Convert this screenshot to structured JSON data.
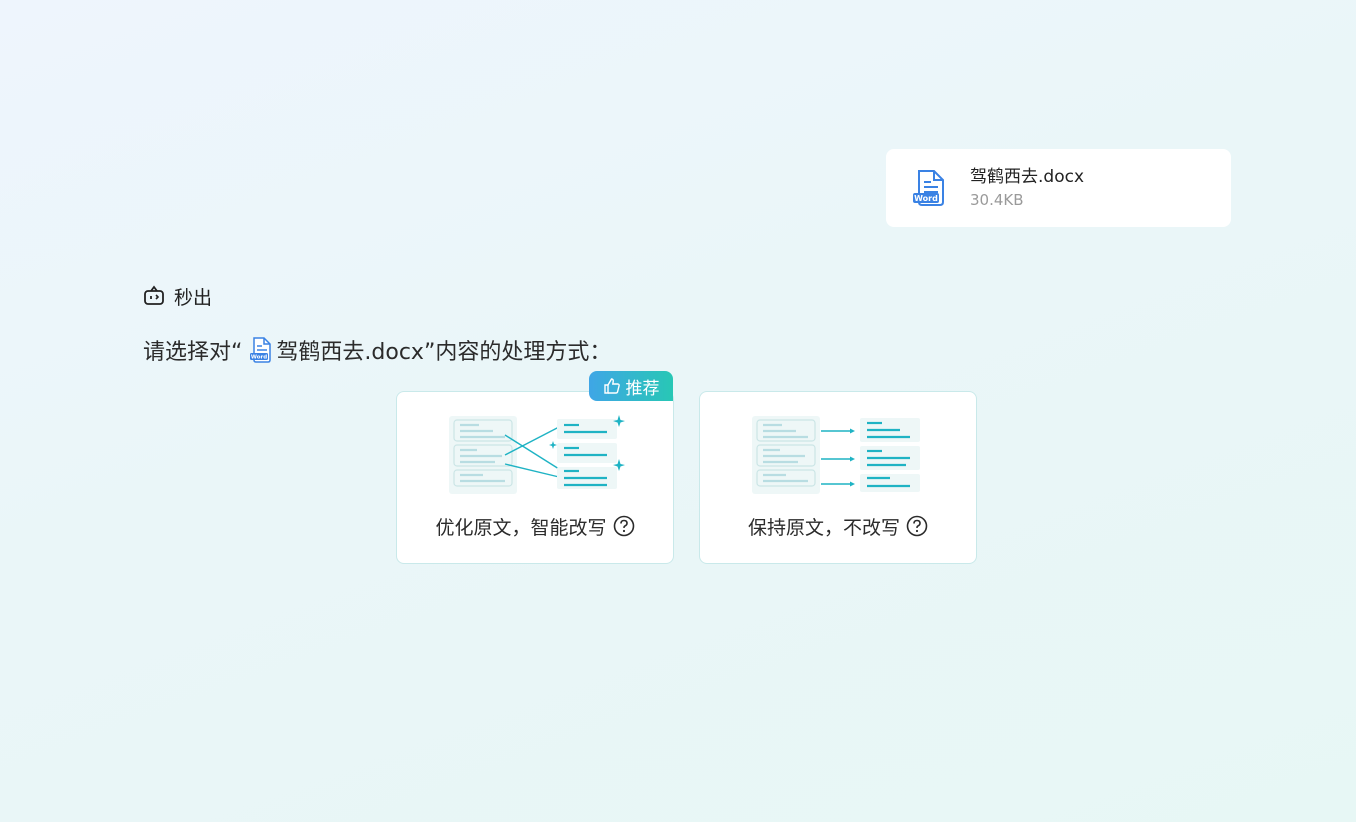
{
  "file": {
    "name": "驾鹤西去.docx",
    "size": "30.4KB",
    "icon": "word-file-icon"
  },
  "sender": {
    "name": "秒出",
    "icon": "bot-icon"
  },
  "prompt": {
    "prefix": "请选择对“",
    "file_name": "驾鹤西去.docx",
    "suffix": "”内容的处理方式："
  },
  "options": [
    {
      "label": "优化原文，智能改写",
      "icon": "help-icon",
      "badge": "推荐",
      "badge_icon": "thumbs-up-icon"
    },
    {
      "label": "保持原文，不改写",
      "icon": "help-icon"
    }
  ],
  "colors": {
    "accent": "#1fb3c4",
    "badge_from": "#3fa6e6",
    "badge_to": "#28c7b5",
    "word_blue": "#3a82e4"
  }
}
